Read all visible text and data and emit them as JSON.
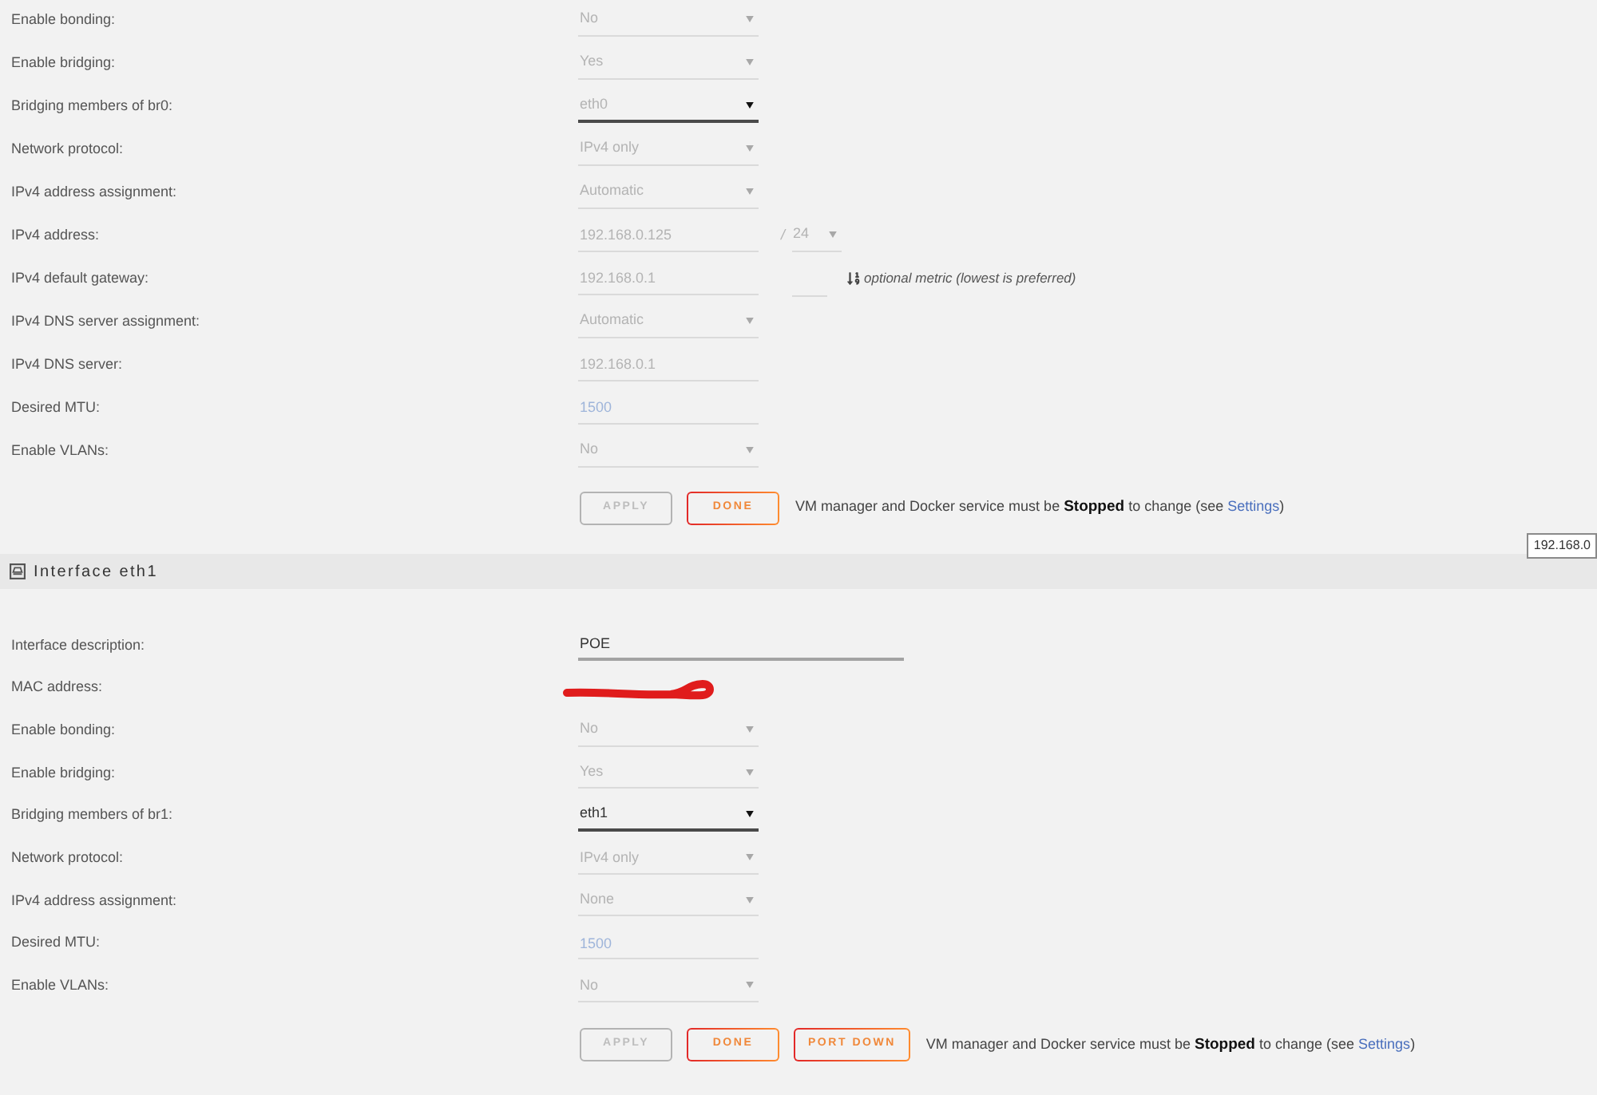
{
  "sections": [
    {
      "rows": [
        {
          "label": "Enable bonding:",
          "field": {
            "kind": "select",
            "value": "No",
            "disabled": true,
            "muted": true
          }
        },
        {
          "label": "Enable bridging:",
          "field": {
            "kind": "select",
            "value": "Yes",
            "disabled": true,
            "muted": true
          }
        },
        {
          "label": "Bridging members of br0:",
          "field": {
            "kind": "select",
            "value": "eth0",
            "disabled": false,
            "muted": true
          }
        },
        {
          "label": "Network protocol:",
          "field": {
            "kind": "select",
            "value": "IPv4 only",
            "disabled": true,
            "muted": true
          }
        },
        {
          "label": "IPv4 address assignment:",
          "field": {
            "kind": "select",
            "value": "Automatic",
            "disabled": true,
            "muted": true
          }
        },
        {
          "label": "IPv4 address:",
          "field": {
            "kind": "text",
            "value": "192.168.0.125",
            "disabled": true,
            "muted": true
          },
          "extra": {
            "kind": "prefix",
            "separator": "/",
            "field": {
              "kind": "select",
              "value": "24",
              "disabled": true,
              "muted": true
            }
          }
        },
        {
          "label": "IPv4 default gateway:",
          "field": {
            "kind": "text",
            "value": "192.168.0.1",
            "disabled": true,
            "muted": true
          },
          "extra": {
            "kind": "metric",
            "field": {
              "kind": "text",
              "disabled": true,
              "muted": true
            },
            "hint": "optional metric (lowest is preferred)"
          }
        },
        {
          "label": "IPv4 DNS server assignment:",
          "field": {
            "kind": "select",
            "value": "Automatic",
            "disabled": true,
            "muted": true
          }
        },
        {
          "label": "IPv4 DNS server:",
          "field": {
            "kind": "text",
            "value": "192.168.0.1",
            "disabled": true,
            "muted": true
          }
        },
        {
          "label": "Desired MTU:",
          "field": {
            "kind": "text",
            "placeholder": "1500",
            "disabled": true,
            "muted": true
          }
        },
        {
          "label": "Enable VLANs:",
          "field": {
            "kind": "select",
            "value": "No",
            "disabled": true,
            "muted": true
          }
        }
      ],
      "buttons": [
        {
          "label": "APPLY",
          "disabled": true
        },
        {
          "label": "DONE",
          "disabled": false
        }
      ],
      "notice": {
        "text": "VM manager and Docker service must be **Stopped** to change (see ",
        "link": "Settings",
        "end": ")"
      },
      "tooltip": "192.168.0"
    },
    {
      "header": "Interface eth1",
      "rows": [
        {
          "label": "Interface description:",
          "field": {
            "kind": "wide-text",
            "value": "POE",
            "disabled": false,
            "muted": false
          }
        },
        {
          "label": "MAC address:",
          "field": {
            "kind": "redacted"
          }
        },
        {
          "label": "Enable bonding:",
          "field": {
            "kind": "select",
            "value": "No",
            "disabled": true,
            "muted": true
          }
        },
        {
          "label": "Enable bridging:",
          "field": {
            "kind": "select",
            "value": "Yes",
            "disabled": true,
            "muted": true
          }
        },
        {
          "label": "Bridging members of br1:",
          "field": {
            "kind": "select",
            "value": "eth1",
            "disabled": false,
            "muted": false
          }
        },
        {
          "label": "Network protocol:",
          "field": {
            "kind": "select",
            "value": "IPv4 only",
            "disabled": true,
            "muted": true
          }
        },
        {
          "label": "IPv4 address assignment:",
          "field": {
            "kind": "select",
            "value": "None",
            "disabled": true,
            "muted": true
          }
        },
        {
          "label": "Desired MTU:",
          "field": {
            "kind": "text",
            "placeholder": "1500",
            "disabled": true,
            "muted": true
          }
        },
        {
          "label": "Enable VLANs:",
          "field": {
            "kind": "select",
            "value": "No",
            "disabled": true,
            "muted": true
          }
        }
      ],
      "buttons": [
        {
          "label": "APPLY",
          "disabled": true
        },
        {
          "label": "DONE",
          "disabled": false
        },
        {
          "label": "PORT DOWN",
          "disabled": false
        }
      ],
      "notice": {
        "text": "VM manager and Docker service must be **Stopped** to change (see ",
        "link": "Settings",
        "end": ")"
      }
    }
  ]
}
